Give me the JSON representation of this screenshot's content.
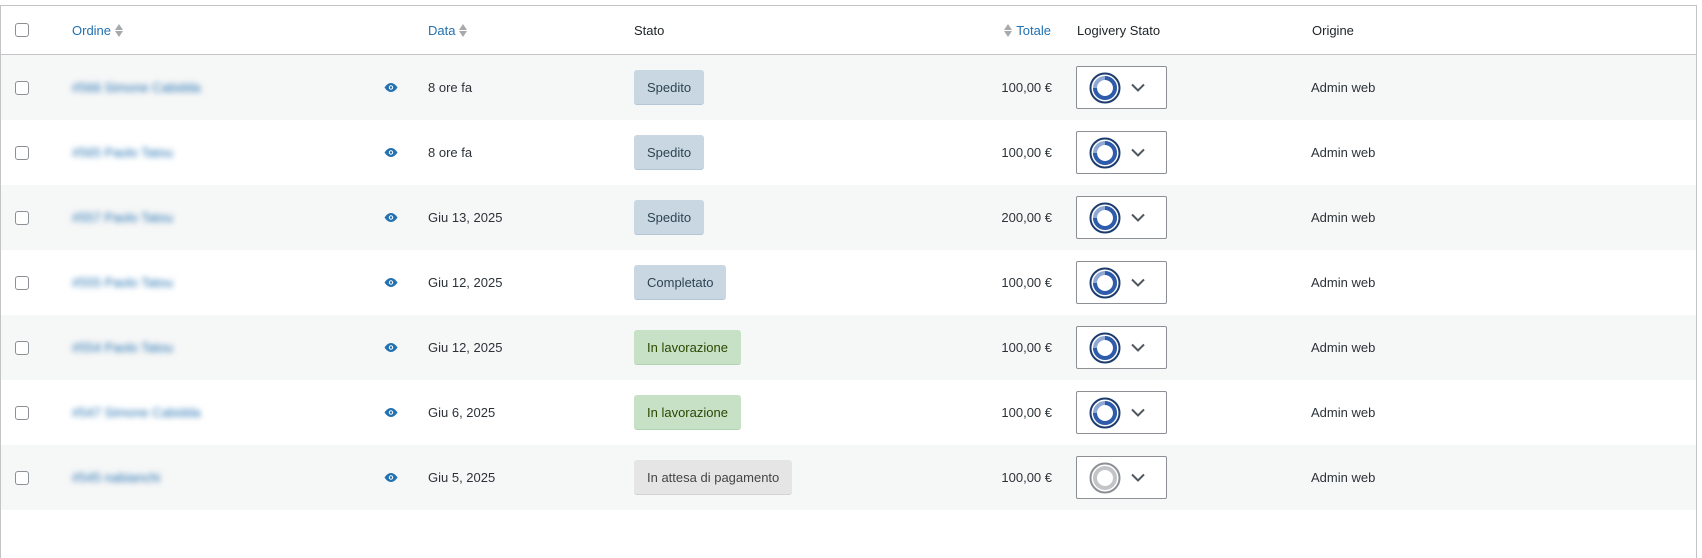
{
  "header": {
    "order": "Ordine",
    "date": "Data",
    "status": "Stato",
    "total": "Totale",
    "logivery": "Logivery Stato",
    "origin": "Origine"
  },
  "colors": {
    "link": "#2271b1",
    "badge_blue": "#c8d7e1",
    "badge_green": "#c6e1c6",
    "badge_gray": "#e5e5e5"
  },
  "rows": [
    {
      "order": "#566 Simone Cabidda",
      "date": "8 ore fa",
      "status": "Spedito",
      "status_style": "blue",
      "total": "100,00 €",
      "logivery_icon": "progress-ring-blue-icon",
      "origin": "Admin web"
    },
    {
      "order": "#565 Paolo Tatou",
      "date": "8 ore fa",
      "status": "Spedito",
      "status_style": "blue",
      "total": "100,00 €",
      "logivery_icon": "progress-ring-blue-icon",
      "origin": "Admin web"
    },
    {
      "order": "#557 Paolo Tatou",
      "date": "Giu 13, 2025",
      "status": "Spedito",
      "status_style": "blue",
      "total": "200,00 €",
      "logivery_icon": "progress-ring-blue-icon",
      "origin": "Admin web"
    },
    {
      "order": "#555 Paolo Tatou",
      "date": "Giu 12, 2025",
      "status": "Completato",
      "status_style": "blue",
      "total": "100,00 €",
      "logivery_icon": "progress-ring-blue-icon",
      "origin": "Admin web"
    },
    {
      "order": "#554 Paolo Tatou",
      "date": "Giu 12, 2025",
      "status": "In lavorazione",
      "status_style": "green",
      "total": "100,00 €",
      "logivery_icon": "progress-ring-blue-icon",
      "origin": "Admin web"
    },
    {
      "order": "#547 Simone Cabidda",
      "date": "Giu 6, 2025",
      "status": "In lavorazione",
      "status_style": "green",
      "total": "100,00 €",
      "logivery_icon": "progress-ring-blue-icon",
      "origin": "Admin web"
    },
    {
      "order": "#545 nabianchi",
      "date": "Giu 5, 2025",
      "status": "In attesa di pagamento",
      "status_style": "gray",
      "total": "100,00 €",
      "logivery_icon": "progress-ring-gray-icon",
      "origin": "Admin web"
    }
  ]
}
